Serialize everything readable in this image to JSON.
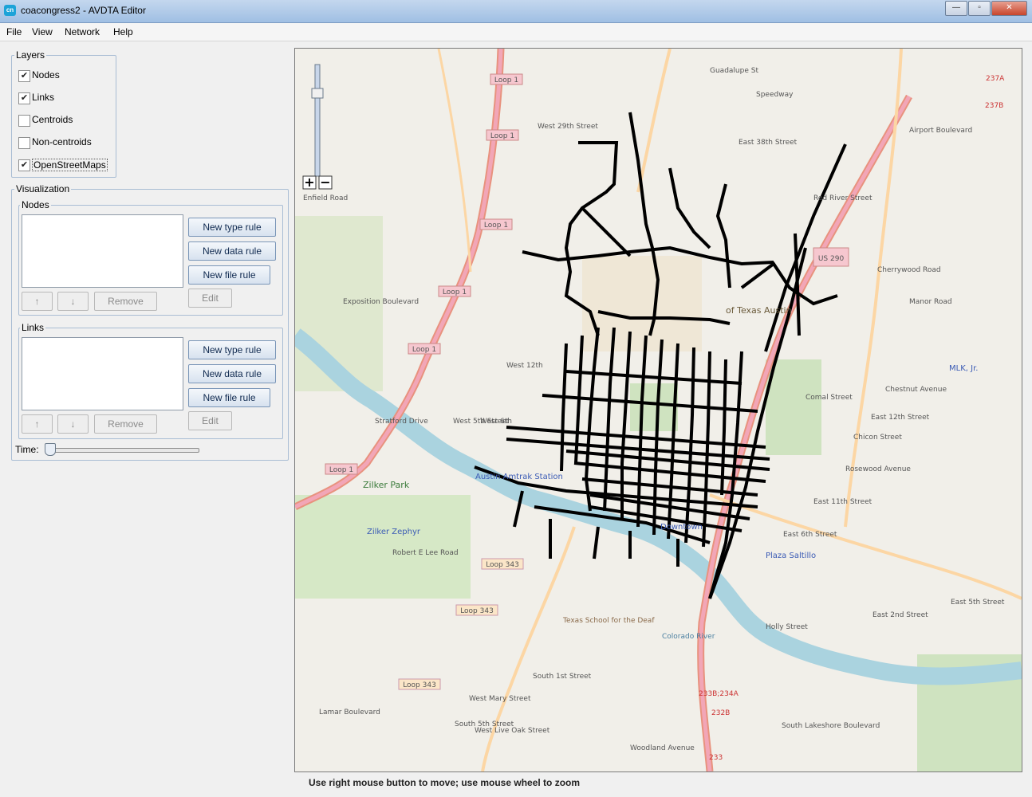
{
  "window": {
    "title": "coacongress2 - AVDTA Editor",
    "icon_label": "cn"
  },
  "menu": [
    "File",
    "View",
    "Network",
    "Help"
  ],
  "layers": {
    "title": "Layers",
    "items": [
      {
        "label": "Nodes",
        "checked": true
      },
      {
        "label": "Links",
        "checked": true
      },
      {
        "label": "Centroids",
        "checked": false
      },
      {
        "label": "Non-centroids",
        "checked": false
      },
      {
        "label": "OpenStreetMaps",
        "checked": true
      }
    ]
  },
  "visualization": {
    "title": "Visualization",
    "nodes": {
      "title": "Nodes",
      "new_type": "New type rule",
      "new_data": "New data rule",
      "new_file": "New file rule",
      "up": "↑",
      "down": "↓",
      "remove": "Remove",
      "edit": "Edit"
    },
    "links": {
      "title": "Links",
      "new_type": "New type rule",
      "new_data": "New data rule",
      "new_file": "New file rule",
      "up": "↑",
      "down": "↓",
      "remove": "Remove",
      "edit": "Edit"
    },
    "time_label": "Time:",
    "time_value": 0
  },
  "map": {
    "zoom_in": "+",
    "zoom_out": "−",
    "labels": {
      "loop1": "Loop 1",
      "loop343": "Loop 343",
      "i35_237a": "237A",
      "i35_237b": "237B",
      "i35_233": "233",
      "i35_232b": "232B",
      "i35_233b": "233B;234A",
      "us290": "US 290",
      "amtrak": "Austin Amtrak Station",
      "downtown": "Downtown",
      "mlk": "MLK, Jr.",
      "plaza": "Plaza Saltillo",
      "zilker_park": "Zilker Park",
      "zilker_zephyr": "Zilker Zephyr",
      "ut": "of Texas\nAustin",
      "colorado": "Colorado River",
      "deaf": "Texas School for the Deaf",
      "lamar": "Lamar Boulevard",
      "airport": "Airport Boulevard",
      "manor": "Manor Road",
      "e12": "East 12th Street",
      "e11": "East 11th Street",
      "e6": "East 6th Street",
      "e5": "East 5th Street",
      "e2": "East 2nd Street",
      "rosewood": "Rosewood Avenue",
      "w6": "West 6th",
      "w5": "West 5th Street",
      "w12": "West 12th",
      "w29": "West 29th Street",
      "guadalupe": "Guadalupe St",
      "speedway": "Speedway",
      "duval": "East 38th Street",
      "red_river": "Red River Street",
      "lakeshore": "South Lakeshore Boulevard",
      "enfield": "Enfield Road",
      "exposition": "Exposition Boulevard",
      "stratford": "Stratford Drive",
      "barton": "Robert E Lee Road",
      "s1": "South 1st Street",
      "s5": "South 5th Street",
      "w_mary": "West Mary Street",
      "chestnut": "Chestnut Avenue",
      "chicon": "Chicon Street",
      "comal": "Comal Street",
      "holly": "Holly Street",
      "cherrywood": "Cherrywood Road",
      "westlive": "West Live Oak Street",
      "woodland": "Woodland Avenue"
    }
  },
  "status": "Use right mouse button to move; use mouse wheel to zoom"
}
